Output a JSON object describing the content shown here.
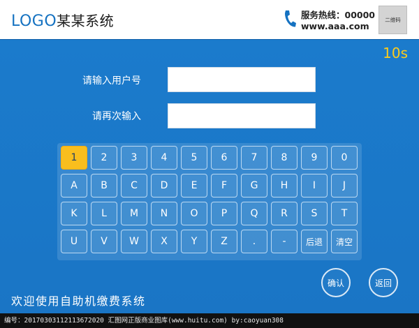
{
  "header": {
    "logo_en": "LOGO",
    "logo_cn": "某某系统",
    "hotline": "服务热线：00000",
    "website": "www.aaa.com",
    "qrcode_label": "二维码"
  },
  "timer": "10s",
  "form": {
    "username_label": "请输入用户号",
    "confirm_label": "请再次输入",
    "username_value": "",
    "confirm_value": ""
  },
  "keyboard": {
    "rows": [
      [
        "1",
        "2",
        "3",
        "4",
        "5",
        "6",
        "7",
        "8",
        "9",
        "0"
      ],
      [
        "A",
        "B",
        "C",
        "D",
        "E",
        "F",
        "G",
        "H",
        "I",
        "J"
      ],
      [
        "K",
        "L",
        "M",
        "N",
        "O",
        "P",
        "Q",
        "R",
        "S",
        "T"
      ],
      [
        "U",
        "V",
        "W",
        "X",
        "Y",
        "Z",
        ".",
        "-",
        "后退",
        "清空"
      ]
    ],
    "active_key": "1"
  },
  "buttons": {
    "confirm": "确认",
    "back": "返回"
  },
  "welcome": "欢迎使用自助机缴费系统",
  "footer": {
    "text": "编号：20170303112113672020    汇图网正版商业图库(www.huitu.com) by:caoyuan308"
  },
  "colors": {
    "brand_blue": "#1a78c8",
    "active_key": "#f9be1e",
    "timer": "#ffcc1a"
  }
}
